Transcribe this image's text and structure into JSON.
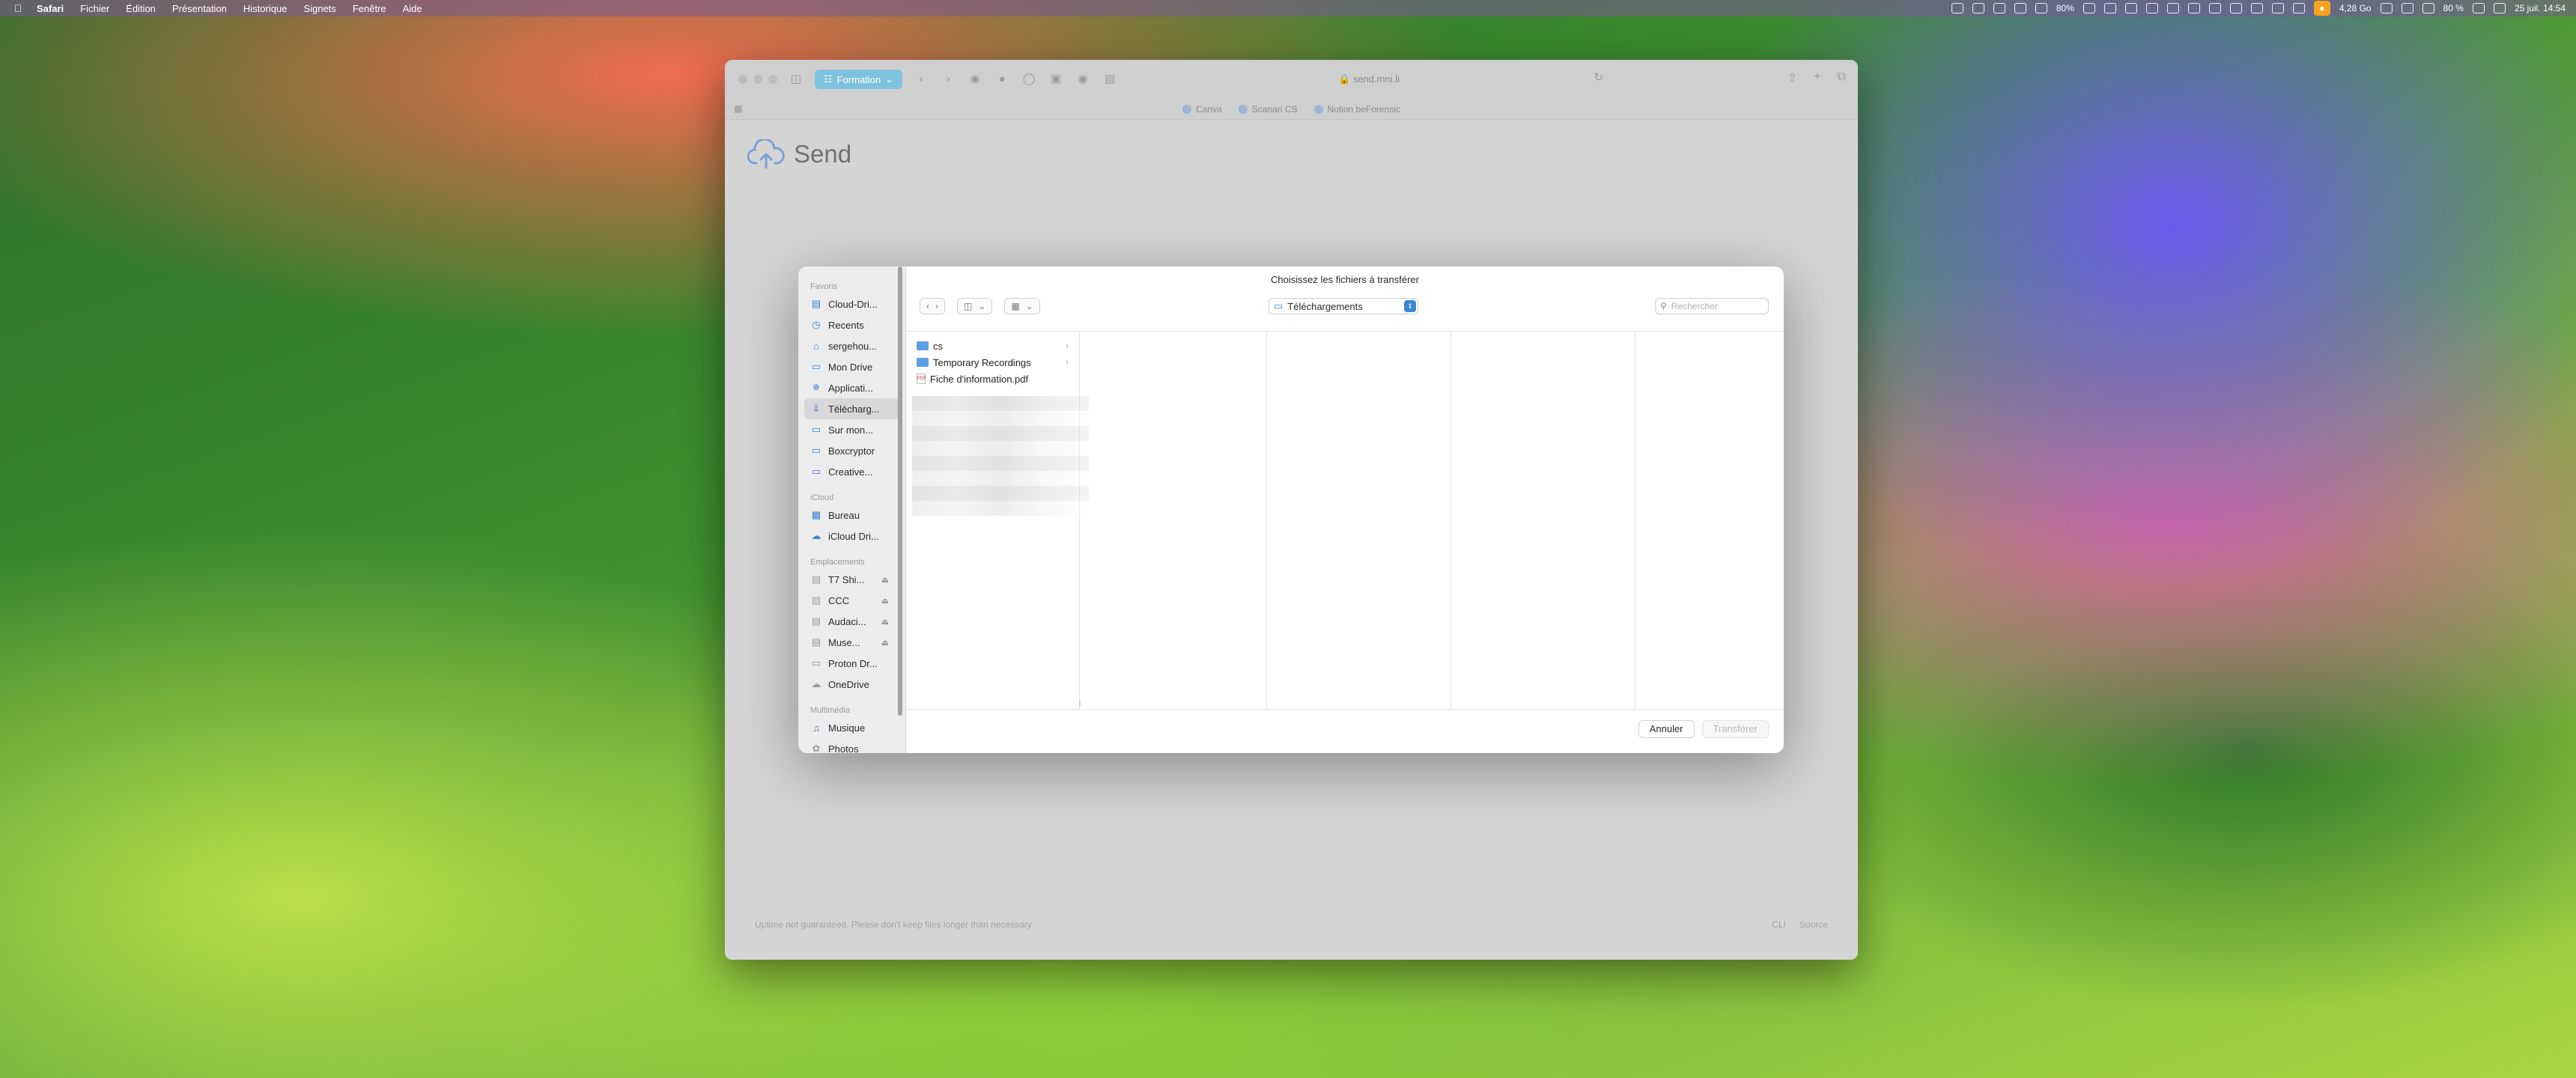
{
  "menubar": {
    "app": "Safari",
    "items": [
      "Fichier",
      "Édition",
      "Présentation",
      "Historique",
      "Signets",
      "Fenêtre",
      "Aide"
    ],
    "status": {
      "cpu": "80%",
      "storage": "4,28 Go",
      "battery": "80 %",
      "datetime": "25 juil. 14:54"
    }
  },
  "browser": {
    "tab_group": "Formation",
    "address": "send.mni.li",
    "favorites": [
      "Canva",
      "Scanari CS",
      "Notion beForensic"
    ]
  },
  "page": {
    "title": "Send",
    "footer_left": "Uptime not guaranteed. Please don't keep files longer than necessary",
    "footer_links": [
      "CLI",
      "Source"
    ]
  },
  "dialog": {
    "title": "Choisissez les fichiers à transférer",
    "location": "Téléchargements",
    "search_placeholder": "Rechercher",
    "sidebar": {
      "favoris_label": "Favoris",
      "favoris": [
        {
          "label": "Cloud-Dri...",
          "icon": "doc-icon"
        },
        {
          "label": "Recents",
          "icon": "clock-icon"
        },
        {
          "label": "sergehou...",
          "icon": "home-icon"
        },
        {
          "label": "Mon Drive",
          "icon": "folder-icon"
        },
        {
          "label": "Applicati...",
          "icon": "applications-icon"
        },
        {
          "label": "Télécharg...",
          "icon": "download-icon"
        },
        {
          "label": "Sur mon...",
          "icon": "folder-icon"
        },
        {
          "label": "Boxcryptor",
          "icon": "folder-icon"
        },
        {
          "label": "Creative...",
          "icon": "folder-icon"
        }
      ],
      "icloud_label": "iCloud",
      "icloud": [
        {
          "label": "Bureau",
          "icon": "desktop-icon"
        },
        {
          "label": "iCloud Dri...",
          "icon": "cloud-icon"
        }
      ],
      "emplacements_label": "Emplacements",
      "emplacements": [
        {
          "label": "T7 Shi...",
          "icon": "drive-icon"
        },
        {
          "label": "CCC",
          "icon": "drive-icon"
        },
        {
          "label": "Audaci...",
          "icon": "drive-icon"
        },
        {
          "label": "Muse...",
          "icon": "drive-icon"
        },
        {
          "label": "Proton Dr...",
          "icon": "folder-icon"
        },
        {
          "label": "OneDrive",
          "icon": "cloud-icon"
        }
      ],
      "multimedia_label": "Multimédia",
      "multimedia": [
        {
          "label": "Musique",
          "icon": "music-icon"
        },
        {
          "label": "Photos",
          "icon": "photos-icon"
        }
      ]
    },
    "files": [
      {
        "name": "cs",
        "type": "folder"
      },
      {
        "name": "Temporary Recordings",
        "type": "folder"
      },
      {
        "name": "Fiche d'information.pdf",
        "type": "pdf"
      }
    ],
    "cancel_label": "Annuler",
    "confirm_label": "Transférer"
  }
}
